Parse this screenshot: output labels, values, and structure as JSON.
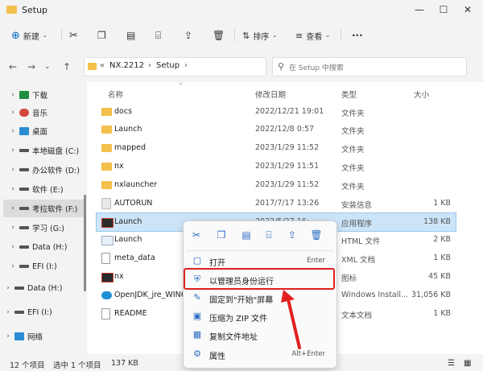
{
  "window": {
    "title": "Setup",
    "minimize": "—",
    "maximize": "☐",
    "close": "✕"
  },
  "toolbar": {
    "new_label": "新建",
    "sort_label": "排序",
    "view_label": "查看",
    "more": "···"
  },
  "address": {
    "prefix": "«",
    "crumbs": [
      "NX.2212",
      "Setup"
    ],
    "sep": "›"
  },
  "search": {
    "placeholder": "在 Setup 中搜索"
  },
  "sidebar": {
    "items": [
      {
        "label": "下载",
        "icon": "download-icon",
        "color": "#1e8f3d"
      },
      {
        "label": "音乐",
        "icon": "music-icon",
        "color": "#d4463b"
      },
      {
        "label": "桌面",
        "icon": "desktop-icon",
        "color": "#2a8dd4"
      },
      {
        "label": "本地磁盘 (C:)",
        "icon": "drive-icon",
        "color": "#555555"
      },
      {
        "label": "办公软件 (D:)",
        "icon": "drive-icon",
        "color": "#555555"
      },
      {
        "label": "软件 (E:)",
        "icon": "drive-icon",
        "color": "#555555"
      },
      {
        "label": "考拉软件 (F:)",
        "icon": "drive-icon",
        "color": "#555555",
        "selected": true
      },
      {
        "label": "学习 (G:)",
        "icon": "drive-icon",
        "color": "#555555"
      },
      {
        "label": "Data (H:)",
        "icon": "drive-icon",
        "color": "#555555"
      },
      {
        "label": "EFI (I:)",
        "icon": "drive-icon",
        "color": "#555555"
      },
      {
        "label": "Data (H:)",
        "icon": "drive-icon",
        "color": "#555555"
      },
      {
        "label": "EFI (I:)",
        "icon": "drive-icon",
        "color": "#555555"
      },
      {
        "label": "网络",
        "icon": "network-icon",
        "color": "#2a8dd4"
      }
    ]
  },
  "columns": {
    "name": "名称",
    "date": "修改日期",
    "type": "类型",
    "size": "大小"
  },
  "files": [
    {
      "name": "docs",
      "date": "2022/12/21 19:01",
      "type": "文件夹",
      "size": "",
      "kind": "folder"
    },
    {
      "name": "Launch",
      "date": "2022/12/8 0:57",
      "type": "文件夹",
      "size": "",
      "kind": "folder"
    },
    {
      "name": "mapped",
      "date": "2023/1/29 11:52",
      "type": "文件夹",
      "size": "",
      "kind": "folder"
    },
    {
      "name": "nx",
      "date": "2023/1/29 11:51",
      "type": "文件夹",
      "size": "",
      "kind": "folder"
    },
    {
      "name": "nxlauncher",
      "date": "2023/1/29 11:52",
      "type": "文件夹",
      "size": "",
      "kind": "folder"
    },
    {
      "name": "AUTORUN",
      "date": "2017/7/17 13:26",
      "type": "安装信息",
      "size": "1 KB",
      "kind": "file"
    },
    {
      "name": "Launch",
      "date": "2022/5/27 16:21",
      "type": "应用程序",
      "size": "138 KB",
      "kind": "nx",
      "selected": true
    },
    {
      "name": "Launch",
      "date": "",
      "type": "HTML 文件",
      "size": "2 KB",
      "kind": "file"
    },
    {
      "name": "meta_data",
      "date": "",
      "type": "XML 文档",
      "size": "1 KB",
      "kind": "file"
    },
    {
      "name": "nx",
      "date": "",
      "type": "图标",
      "size": "45 KB",
      "kind": "nx"
    },
    {
      "name": "OpenJDK_jre_WIN64",
      "date": "",
      "type": "Windows Install...",
      "size": "31,056 KB",
      "kind": "file"
    },
    {
      "name": "README",
      "date": "",
      "type": "文本文档",
      "size": "1 KB",
      "kind": "file"
    }
  ],
  "context_menu": {
    "items": [
      {
        "label": "打开",
        "shortcut": "Enter",
        "icon": "open-icon"
      },
      {
        "label": "以管理员身份运行",
        "shortcut": "",
        "icon": "shield-icon"
      },
      {
        "label": "固定到\"开始\"屏幕",
        "shortcut": "",
        "icon": "pin-icon"
      },
      {
        "label": "压缩为 ZIP 文件",
        "shortcut": "",
        "icon": "zip-icon"
      },
      {
        "label": "复制文件地址",
        "shortcut": "",
        "icon": "copy-path-icon"
      },
      {
        "label": "属性",
        "shortcut": "Alt+Enter",
        "icon": "properties-icon"
      }
    ]
  },
  "status": {
    "count": "12 个项目",
    "selected": "选中 1 个项目",
    "size": "137 KB"
  },
  "colors": {
    "accent": "#0067c0",
    "folder": "#f2c04b",
    "highlight": "#e02020",
    "selection": "#cce4f7"
  }
}
